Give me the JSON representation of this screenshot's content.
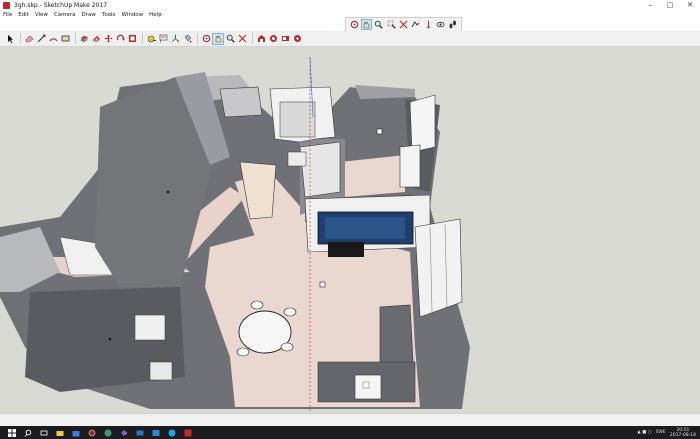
{
  "window": {
    "title": "3gh.skp - SketchUp Make 2017"
  },
  "menu": [
    "File",
    "Edit",
    "View",
    "Camera",
    "Draw",
    "Tools",
    "Window",
    "Help"
  ],
  "float_toolbar": {
    "icons": [
      "orbit-icon",
      "pan-icon",
      "zoom-icon",
      "zoom-window-icon",
      "zoom-extents-icon",
      "previous-view-icon",
      "position-camera-icon",
      "look-around-icon",
      "walk-icon"
    ],
    "active_index": 1
  },
  "main_toolbar": {
    "icons": [
      "select-icon",
      "eraser-icon",
      "line-icon",
      "arc-icon",
      "rectangle-icon",
      "push-pull-icon",
      "offset-icon",
      "move-icon",
      "rotate-icon",
      "scale-icon",
      "tape-measure-icon",
      "text-icon",
      "axes-icon",
      "paint-bucket-icon",
      "orbit-icon",
      "pan-icon",
      "zoom-icon",
      "zoom-extents-icon",
      "warehouse-icon",
      "extension-warehouse-icon",
      "layout-icon",
      "extension-manager-icon"
    ],
    "active_index": 15
  },
  "taskbar": {
    "icons": [
      "windows-start-icon",
      "search-icon",
      "task-view-icon",
      "file-explorer-icon",
      "store-icon",
      "firefox-icon",
      "chrome-icon",
      "visual-studio-icon",
      "mail-icon",
      "photos-icon",
      "skype-icon",
      "sketchup-icon"
    ],
    "language": "SWE",
    "time": "20:51",
    "date": "2017-08-18"
  },
  "colors": {
    "viewport_bg": "#d9dad4",
    "floor": "#ead7d0",
    "wall_top": "#f4f4f4",
    "wall_dark": "#6c6d72",
    "accent_red": "#c4262e"
  }
}
